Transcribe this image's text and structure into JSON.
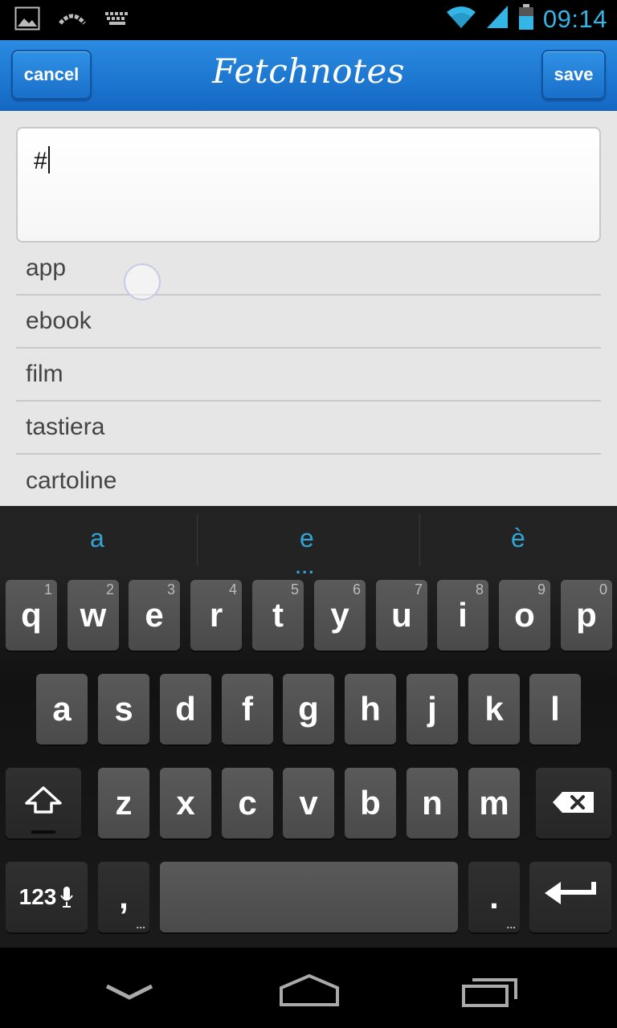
{
  "status_bar": {
    "icons_left": [
      "gallery-icon",
      "signal-arc-icon",
      "keyboard-icon"
    ],
    "icons_right": [
      "wifi-icon",
      "cell-signal-icon",
      "battery-icon"
    ],
    "time": "09:14",
    "accent_color": "#33b5e5"
  },
  "action_bar": {
    "cancel_label": "cancel",
    "title": "Fetchnotes",
    "save_label": "save",
    "color": "#1a74d0"
  },
  "editor": {
    "text": "#"
  },
  "tag_suggestions": [
    {
      "label": "app"
    },
    {
      "label": "ebook"
    },
    {
      "label": "film"
    },
    {
      "label": "tastiera"
    },
    {
      "label": "cartoline"
    }
  ],
  "keyboard": {
    "candidates": [
      "a",
      "e",
      "è"
    ],
    "candidates_more": "...",
    "row1": [
      {
        "label": "q",
        "hint": "1"
      },
      {
        "label": "w",
        "hint": "2"
      },
      {
        "label": "e",
        "hint": "3"
      },
      {
        "label": "r",
        "hint": "4"
      },
      {
        "label": "t",
        "hint": "5"
      },
      {
        "label": "y",
        "hint": "6"
      },
      {
        "label": "u",
        "hint": "7"
      },
      {
        "label": "i",
        "hint": "8"
      },
      {
        "label": "o",
        "hint": "9"
      },
      {
        "label": "p",
        "hint": "0"
      }
    ],
    "row2": [
      "a",
      "s",
      "d",
      "f",
      "g",
      "h",
      "j",
      "k",
      "l"
    ],
    "row3": [
      "z",
      "x",
      "c",
      "v",
      "b",
      "n",
      "m"
    ],
    "symbols_label": "123",
    "comma_label": ",",
    "period_label": ".",
    "more_marker": "..."
  },
  "nav_bar": {
    "icons": [
      "back-icon",
      "home-icon",
      "recent-apps-icon"
    ]
  }
}
